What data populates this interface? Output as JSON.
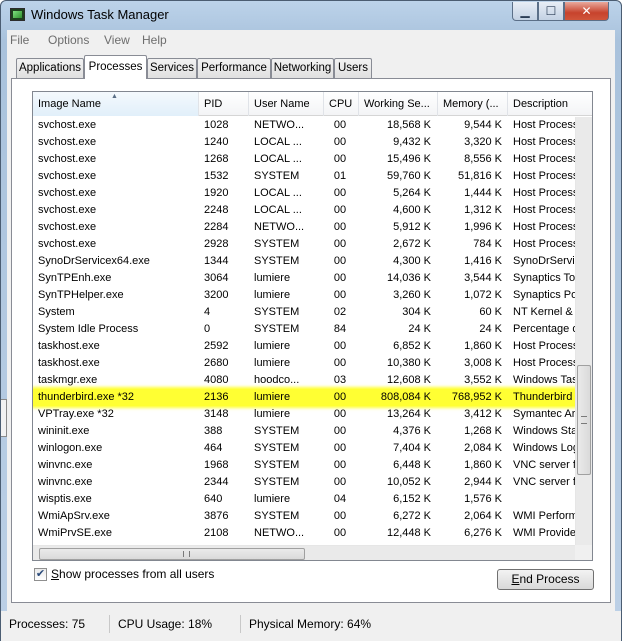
{
  "window": {
    "title": "Windows Task Manager",
    "controls": {
      "minimize": "▁",
      "maximize": "☐",
      "close": "✕"
    }
  },
  "menu": {
    "file": "File",
    "options": "Options",
    "view": "View",
    "help": "Help"
  },
  "tabs": [
    {
      "label": "Applications"
    },
    {
      "label": "Processes",
      "active": true
    },
    {
      "label": "Services"
    },
    {
      "label": "Performance"
    },
    {
      "label": "Networking"
    },
    {
      "label": "Users"
    }
  ],
  "columns": {
    "image_name": "Image Name",
    "pid": "PID",
    "user_name": "User Name",
    "cpu": "CPU",
    "working_set": "Working Se...",
    "memory": "Memory (...",
    "description": "Description"
  },
  "processes": [
    {
      "image": "svchost.exe",
      "pid": "1028",
      "user": "NETWO...",
      "cpu": "00",
      "ws": "18,568 K",
      "mem": "9,544 K",
      "desc": "Host Process"
    },
    {
      "image": "svchost.exe",
      "pid": "1240",
      "user": "LOCAL ...",
      "cpu": "00",
      "ws": "9,432 K",
      "mem": "3,320 K",
      "desc": "Host Process"
    },
    {
      "image": "svchost.exe",
      "pid": "1268",
      "user": "LOCAL ...",
      "cpu": "00",
      "ws": "15,496 K",
      "mem": "8,556 K",
      "desc": "Host Process"
    },
    {
      "image": "svchost.exe",
      "pid": "1532",
      "user": "SYSTEM",
      "cpu": "01",
      "ws": "59,760 K",
      "mem": "51,816 K",
      "desc": "Host Process"
    },
    {
      "image": "svchost.exe",
      "pid": "1920",
      "user": "LOCAL ...",
      "cpu": "00",
      "ws": "5,264 K",
      "mem": "1,444 K",
      "desc": "Host Process"
    },
    {
      "image": "svchost.exe",
      "pid": "2248",
      "user": "LOCAL ...",
      "cpu": "00",
      "ws": "4,600 K",
      "mem": "1,312 K",
      "desc": "Host Process"
    },
    {
      "image": "svchost.exe",
      "pid": "2284",
      "user": "NETWO...",
      "cpu": "00",
      "ws": "5,912 K",
      "mem": "1,996 K",
      "desc": "Host Process"
    },
    {
      "image": "svchost.exe",
      "pid": "2928",
      "user": "SYSTEM",
      "cpu": "00",
      "ws": "2,672 K",
      "mem": "784 K",
      "desc": "Host Process"
    },
    {
      "image": "SynoDrServicex64.exe",
      "pid": "1344",
      "user": "SYSTEM",
      "cpu": "00",
      "ws": "4,300 K",
      "mem": "1,416 K",
      "desc": "SynoDrServi"
    },
    {
      "image": "SynTPEnh.exe",
      "pid": "3064",
      "user": "lumiere",
      "cpu": "00",
      "ws": "14,036 K",
      "mem": "3,544 K",
      "desc": "Synaptics To"
    },
    {
      "image": "SynTPHelper.exe",
      "pid": "3200",
      "user": "lumiere",
      "cpu": "00",
      "ws": "3,260 K",
      "mem": "1,072 K",
      "desc": "Synaptics Po"
    },
    {
      "image": "System",
      "pid": "4",
      "user": "SYSTEM",
      "cpu": "02",
      "ws": "304 K",
      "mem": "60 K",
      "desc": "NT Kernel &"
    },
    {
      "image": "System Idle Process",
      "pid": "0",
      "user": "SYSTEM",
      "cpu": "84",
      "ws": "24 K",
      "mem": "24 K",
      "desc": "Percentage o"
    },
    {
      "image": "taskhost.exe",
      "pid": "2592",
      "user": "lumiere",
      "cpu": "00",
      "ws": "6,852 K",
      "mem": "1,860 K",
      "desc": "Host Process"
    },
    {
      "image": "taskhost.exe",
      "pid": "2680",
      "user": "lumiere",
      "cpu": "00",
      "ws": "10,380 K",
      "mem": "3,008 K",
      "desc": "Host Process"
    },
    {
      "image": "taskmgr.exe",
      "pid": "4080",
      "user": "hoodco...",
      "cpu": "03",
      "ws": "12,608 K",
      "mem": "3,552 K",
      "desc": "Windows Tas"
    },
    {
      "image": "thunderbird.exe *32",
      "pid": "2136",
      "user": "lumiere",
      "cpu": "00",
      "ws": "808,084 K",
      "mem": "768,952 K",
      "desc": "Thunderbird",
      "highlighted": true
    },
    {
      "image": "VPTray.exe *32",
      "pid": "3148",
      "user": "lumiere",
      "cpu": "00",
      "ws": "13,264 K",
      "mem": "3,412 K",
      "desc": "Symantec Ar"
    },
    {
      "image": "wininit.exe",
      "pid": "388",
      "user": "SYSTEM",
      "cpu": "00",
      "ws": "4,376 K",
      "mem": "1,268 K",
      "desc": "Windows Sta"
    },
    {
      "image": "winlogon.exe",
      "pid": "464",
      "user": "SYSTEM",
      "cpu": "00",
      "ws": "7,404 K",
      "mem": "2,084 K",
      "desc": "Windows Log"
    },
    {
      "image": "winvnc.exe",
      "pid": "1968",
      "user": "SYSTEM",
      "cpu": "00",
      "ws": "6,448 K",
      "mem": "1,860 K",
      "desc": "VNC server f"
    },
    {
      "image": "winvnc.exe",
      "pid": "2344",
      "user": "SYSTEM",
      "cpu": "00",
      "ws": "10,052 K",
      "mem": "2,944 K",
      "desc": "VNC server f"
    },
    {
      "image": "wisptis.exe",
      "pid": "640",
      "user": "lumiere",
      "cpu": "04",
      "ws": "6,152 K",
      "mem": "1,576 K",
      "desc": ""
    },
    {
      "image": "WmiApSrv.exe",
      "pid": "3876",
      "user": "SYSTEM",
      "cpu": "00",
      "ws": "6,272 K",
      "mem": "2,064 K",
      "desc": "WMI Perform"
    },
    {
      "image": "WmiPrvSE.exe",
      "pid": "2108",
      "user": "NETWO...",
      "cpu": "00",
      "ws": "12,448 K",
      "mem": "6,276 K",
      "desc": "WMI Provide"
    }
  ],
  "show_all_users": {
    "checked": true,
    "mark": "✔",
    "label_underlined": "S",
    "label_rest": "how processes from all users"
  },
  "end_process": {
    "label_underlined": "E",
    "label_rest": "nd Process"
  },
  "status": {
    "processes": "Processes: 75",
    "cpu_usage": "CPU Usage: 18%",
    "physical_memory": "Physical Memory: 64%"
  },
  "colors": {
    "highlight": "#ffff33",
    "window_frame": "#bcd3ea"
  }
}
